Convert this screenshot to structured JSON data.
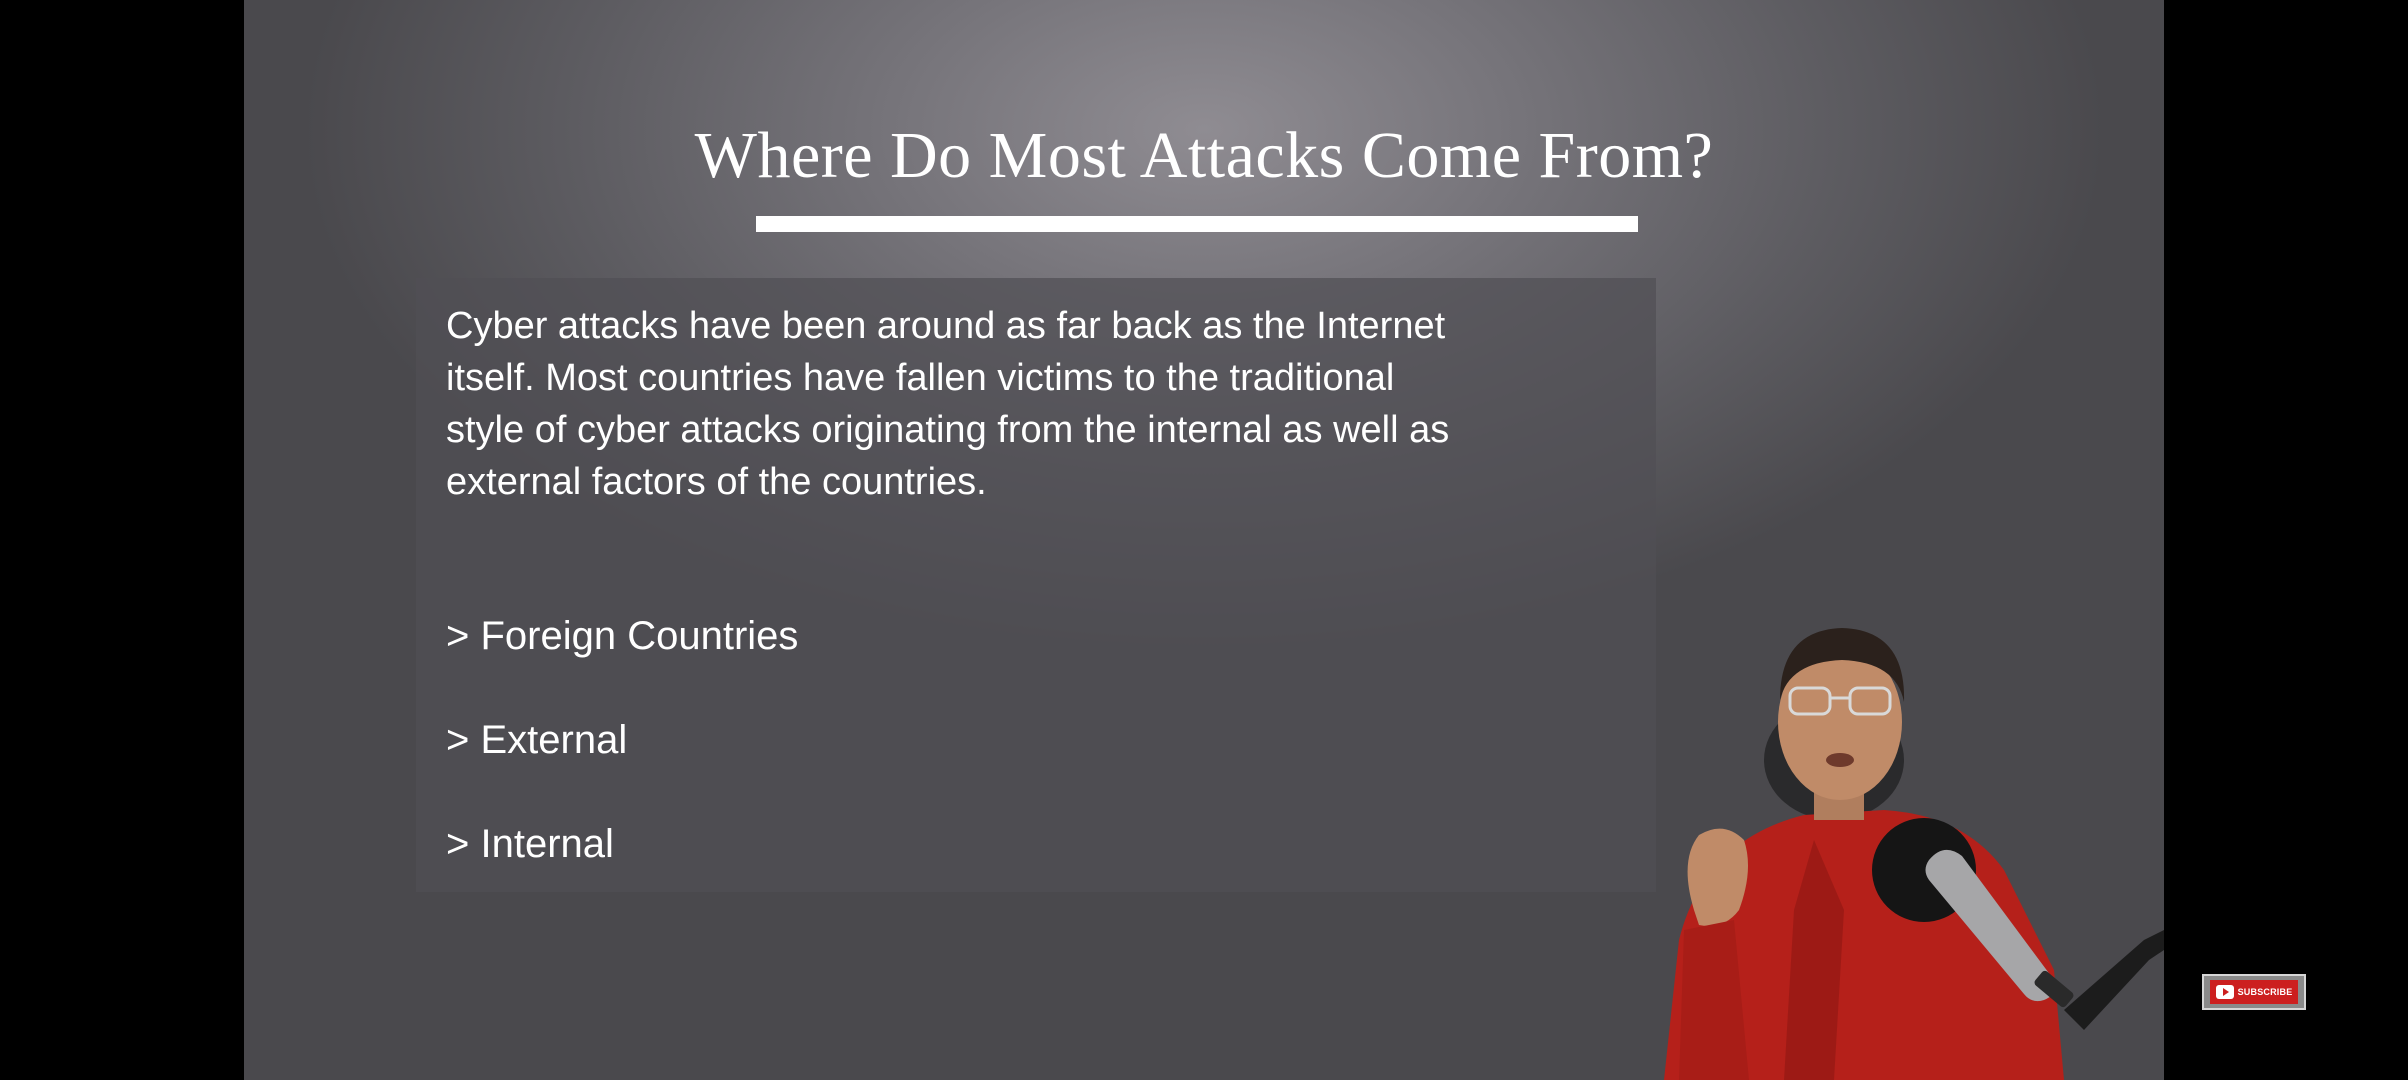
{
  "slide": {
    "title": "Where Do Most Attacks Come From?",
    "intro_lines": [
      "Cyber attacks have been around as far back as the Internet",
      "itself. Most countries have fallen victims to the traditional",
      "style of cyber attacks originating from the internal as well as",
      "external factors of the countries."
    ],
    "sources": [
      "> Foreign Countries",
      "> External",
      "> Internal"
    ]
  },
  "subscribe_badge": {
    "label": "SUBSCRIBE",
    "icon": "youtube-logo-icon"
  },
  "presenter": {
    "shirt_color": "#b5201a",
    "icon": "presenter-figure"
  },
  "colors": {
    "background": "#6a696e",
    "text": "#ffffff",
    "panel": "#505054",
    "accent_red": "#cc1f1f"
  }
}
